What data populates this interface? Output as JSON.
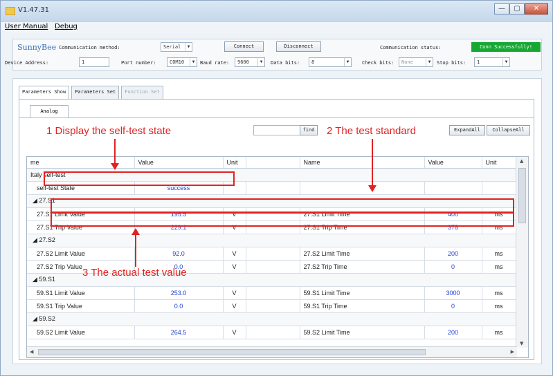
{
  "window": {
    "title": "V1.47.31",
    "buttons": [
      "—",
      "▢",
      "✕"
    ]
  },
  "menu": {
    "items": [
      "User Manual",
      "Debug"
    ]
  },
  "connection": {
    "brand": "SunnyBee",
    "comm_method_label": "Communication method:",
    "comm_method_value": "Serial",
    "connect_label": "Connect",
    "disconnect_label": "Disconnect",
    "comm_status_label": "Communication status:",
    "comm_status_value": "Conn Successfully!",
    "device_address_label": "Device Address:",
    "device_address_value": "1",
    "port_label": "Port number:",
    "port_value": "COM10",
    "baud_label": "Baud rate:",
    "baud_value": "9600",
    "data_bits_label": "Data bits:",
    "data_bits_value": "8",
    "check_bits_label": "Check bits:",
    "check_bits_value": "None",
    "stop_bits_label": "Stop bits:",
    "stop_bits_value": "1",
    "status_color": "#17a834"
  },
  "tabs": [
    "Parameters Show",
    "Parameters Set",
    "Function Set"
  ],
  "subtab": "Analog",
  "toolbar": {
    "find_label": "find",
    "expand_label": "ExpandAll",
    "collapse_label": "CollapseAll"
  },
  "table": {
    "headers": [
      "me",
      "Value",
      "Unit",
      "",
      "Name",
      "Value",
      "Unit"
    ],
    "section": "Italy self-test",
    "state_row": {
      "name": "self-test State",
      "value": "success"
    },
    "groups": [
      {
        "title": "27.S1",
        "rows": [
          {
            "name": "27.S1 Limit Value",
            "value": "195.5",
            "unit": "V",
            "name2": "27.S1 Limit Time",
            "value2": "400",
            "unit2": "ms"
          },
          {
            "name": "27.S1 Trip Value",
            "value": "229.1",
            "unit": "V",
            "name2": "27.S1 Trip Time",
            "value2": "378",
            "unit2": "ms"
          }
        ]
      },
      {
        "title": "27.S2",
        "rows": [
          {
            "name": "27.S2 Limit Value",
            "value": "92.0",
            "unit": "V",
            "name2": "27.S2 Limit Time",
            "value2": "200",
            "unit2": "ms"
          },
          {
            "name": "27.S2 Trip Value",
            "value": "0.0",
            "unit": "V",
            "name2": "27.S2 Trip Time",
            "value2": "0",
            "unit2": "ms"
          }
        ]
      },
      {
        "title": "59.S1",
        "rows": [
          {
            "name": "59.S1 Limit Value",
            "value": "253.0",
            "unit": "V",
            "name2": "59.S1 Limit Time",
            "value2": "3000",
            "unit2": "ms"
          },
          {
            "name": "59.S1 Trip Value",
            "value": "0.0",
            "unit": "V",
            "name2": "59.S1 Trip Time",
            "value2": "0",
            "unit2": "ms"
          }
        ]
      },
      {
        "title": "59.S2",
        "rows": [
          {
            "name": "59.S2 Limit Value",
            "value": "264.5",
            "unit": "V",
            "name2": "59.S2 Limit Time",
            "value2": "200",
            "unit2": "ms"
          }
        ]
      }
    ]
  },
  "annotations": {
    "a1": "1 Display the self-test state",
    "a2": "2 The test standard",
    "a3": "3 The actual test value",
    "color": "#e02222"
  }
}
